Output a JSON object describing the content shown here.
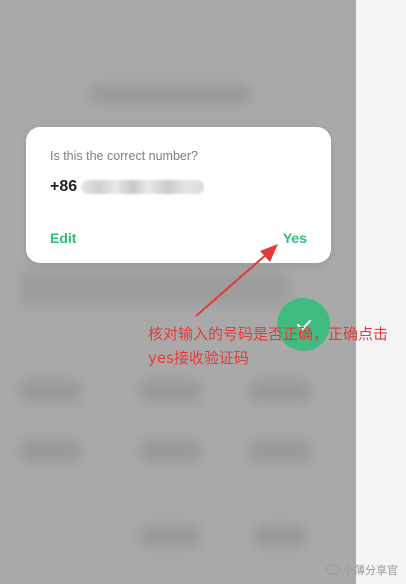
{
  "dialog": {
    "title": "Is this the correct number?",
    "country_code": "+86",
    "edit_label": "Edit",
    "yes_label": "Yes"
  },
  "annotation": {
    "text": "核对输入的号码是否正确，正确点击yes接收验证码"
  },
  "watermark": {
    "text": "小薄分享官"
  },
  "colors": {
    "accent": "#2fbf79",
    "annotation": "#e53a3a",
    "backdrop": "#a9a9a9"
  },
  "icons": {
    "fab": "check-icon",
    "arrow": "annotation-arrow"
  }
}
